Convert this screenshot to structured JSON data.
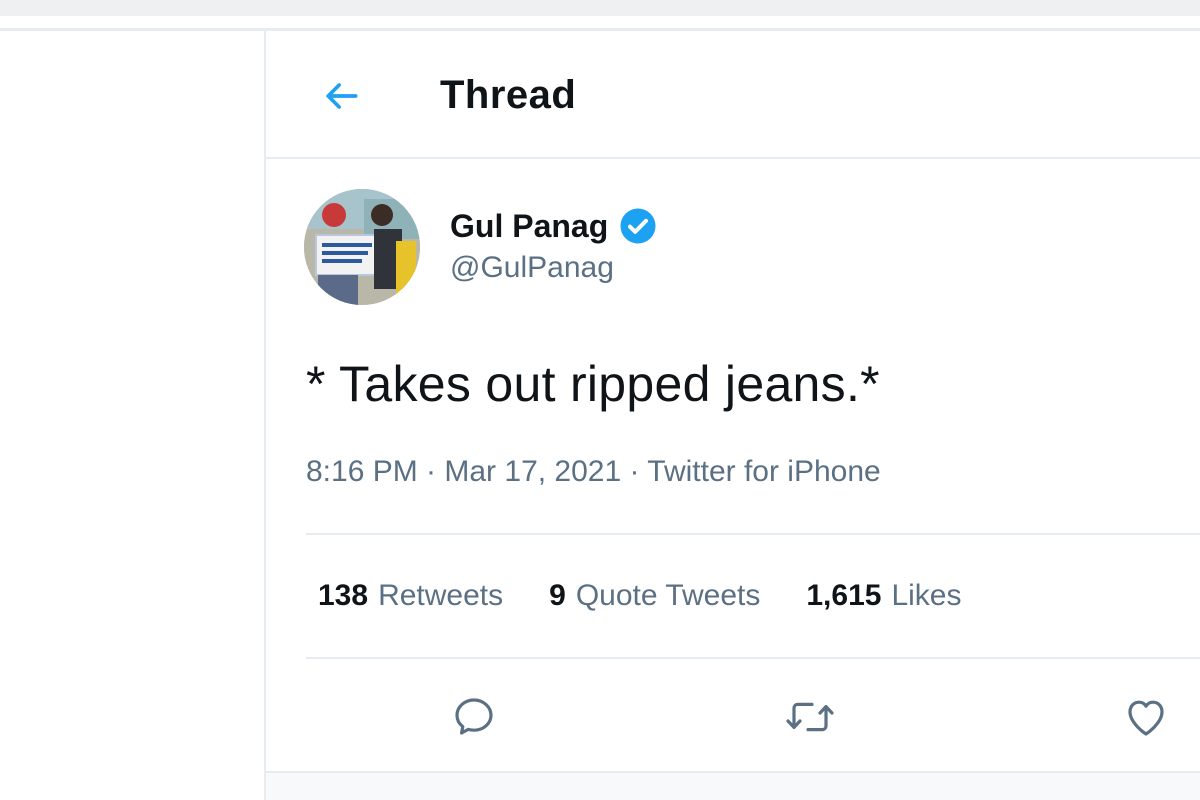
{
  "header": {
    "title": "Thread",
    "back_icon": "arrow-left-icon"
  },
  "tweet": {
    "author_name": "Gul Panag",
    "author_handle": "@GulPanag",
    "verified_icon": "verified-badge-icon",
    "text": "* Takes out ripped jeans.*",
    "meta": "8:16 PM · Mar 17, 2021 · Twitter for iPhone",
    "stats": [
      {
        "count": "138",
        "label": "Retweets"
      },
      {
        "count": "9",
        "label": "Quote Tweets"
      },
      {
        "count": "1,615",
        "label": "Likes"
      }
    ],
    "actions": [
      "reply-icon",
      "retweet-icon",
      "like-icon"
    ]
  },
  "colors": {
    "accent": "#1da1f2",
    "secondary_text": "#5b7083",
    "primary_text": "#0f1419",
    "divider": "#e6ecf0"
  }
}
